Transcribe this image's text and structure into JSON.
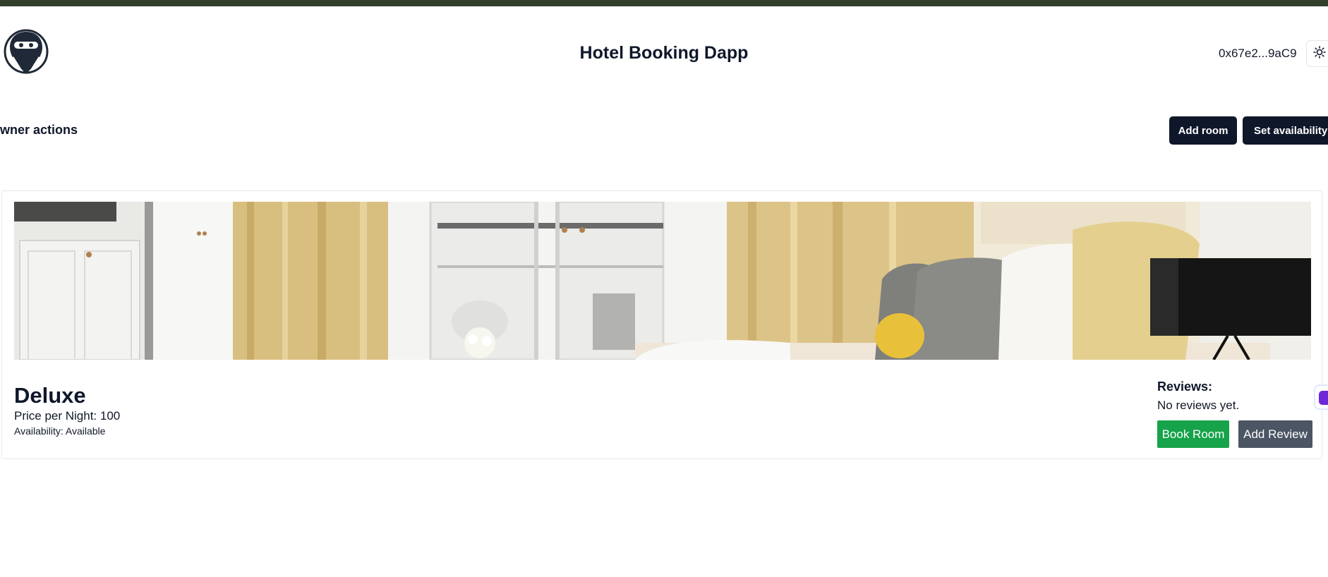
{
  "header": {
    "title": "Hotel Booking Dapp",
    "wallet_address": "0x67e2...9aC9",
    "logo_icon": "ninja-logo-icon",
    "theme_icon": "sun-icon"
  },
  "owner": {
    "label": "wner actions",
    "add_room_label": "Add room",
    "set_availability_label": "Set availability"
  },
  "room": {
    "name": "Deluxe",
    "price_text": "Price per Night: 100",
    "availability_text": "Availability: Available",
    "image_icon": "hotel-room-photo",
    "reviews_title": "Reviews:",
    "reviews_empty": "No reviews yet.",
    "book_label": "Book Room",
    "add_review_label": "Add Review"
  },
  "colors": {
    "top_strip": "#333f2b",
    "dark_button": "#0f172a",
    "book_button": "#16a34a",
    "review_button": "#4b5563",
    "widget": "#6d28d9"
  }
}
